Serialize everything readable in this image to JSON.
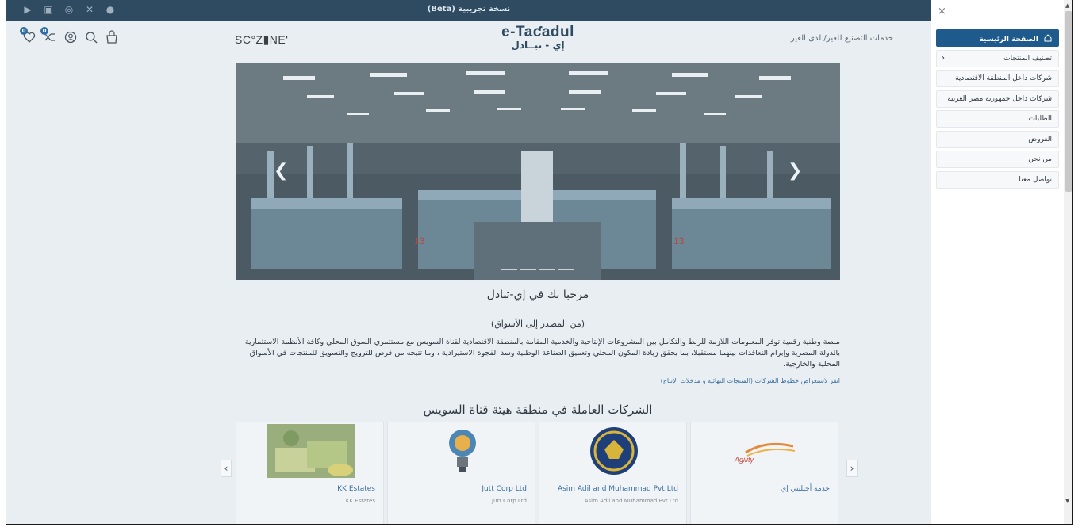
{
  "topbar": {
    "beta_label": "نسخة تجريبية (Beta)",
    "social_icons": [
      "youtube-icon",
      "linkedin-icon",
      "instagram-icon",
      "x-icon",
      "facebook-icon"
    ]
  },
  "header": {
    "wishlist_badge": "0",
    "compare_badge": "0",
    "brand_left": "SC°Z▮NE'",
    "logo_en": "e-Taƈadul",
    "logo_ar": "إي - تبــادل",
    "right_link": "خدمات التصنيع للغير/ لدى الغير"
  },
  "carousel": {
    "slide_count": 4
  },
  "main": {
    "welcome": "مرحبا بك في إي-تبادل",
    "tagline": "(من المصدر إلى الأسواق)",
    "description": "منصة وطنية رقمية توفر المعلومات اللازمة للربط والتكامل بين المشروعات الإنتاجية والخدمية المقامة بالمنطقة الاقتصادية لقناة السويس مع مستثمري السوق المحلي وكافة الأنظمة الاستثمارية بالدولة المصرية وإبرام التعاقدات بينهما مستقبلا، بما يحقق زيادة المكون المحلي وتعميق الصناعة الوطنية وسد الفجوة الاستيرادية ، وما تتيحه من فرص للترويج والتسويق للمنتجات في الأسواق المحلية والخارجية.",
    "link_text": "انقر لاستعراض خطوط الشركات (المنتجات النهائية و مدخلات الإنتاج)",
    "section_title": "الشركات العاملة في منطقة هيئة قناة السويس"
  },
  "companies": [
    {
      "name": "KK Estates",
      "sub": "KK Estates"
    },
    {
      "name": "Jutt Corp Ltd",
      "sub": "Jutt Corp Ltd"
    },
    {
      "name": "Asim Adil and Muhammad Pvt Ltd",
      "sub": "Asim Adil and Muhammad Pvt Ltd"
    },
    {
      "name": "خدمة أجيليتي إي",
      "sub": ""
    }
  ],
  "drawer": {
    "close_label": "×",
    "items": [
      {
        "label": "الصفحة الرئيسية",
        "active": true
      },
      {
        "label": "تصنيف المنتجات"
      },
      {
        "label": "شركات داخل المنطقة الاقتصادية"
      },
      {
        "label": "شركات داخل جمهورية مصر العربية"
      },
      {
        "label": "الطلبات"
      },
      {
        "label": "العروض"
      },
      {
        "label": "من نحن"
      },
      {
        "label": "تواصل معنا"
      }
    ]
  },
  "colors": {
    "topbar": "#2f4b62",
    "active_menu": "#1e5a8c",
    "link": "#3a6f9f"
  }
}
